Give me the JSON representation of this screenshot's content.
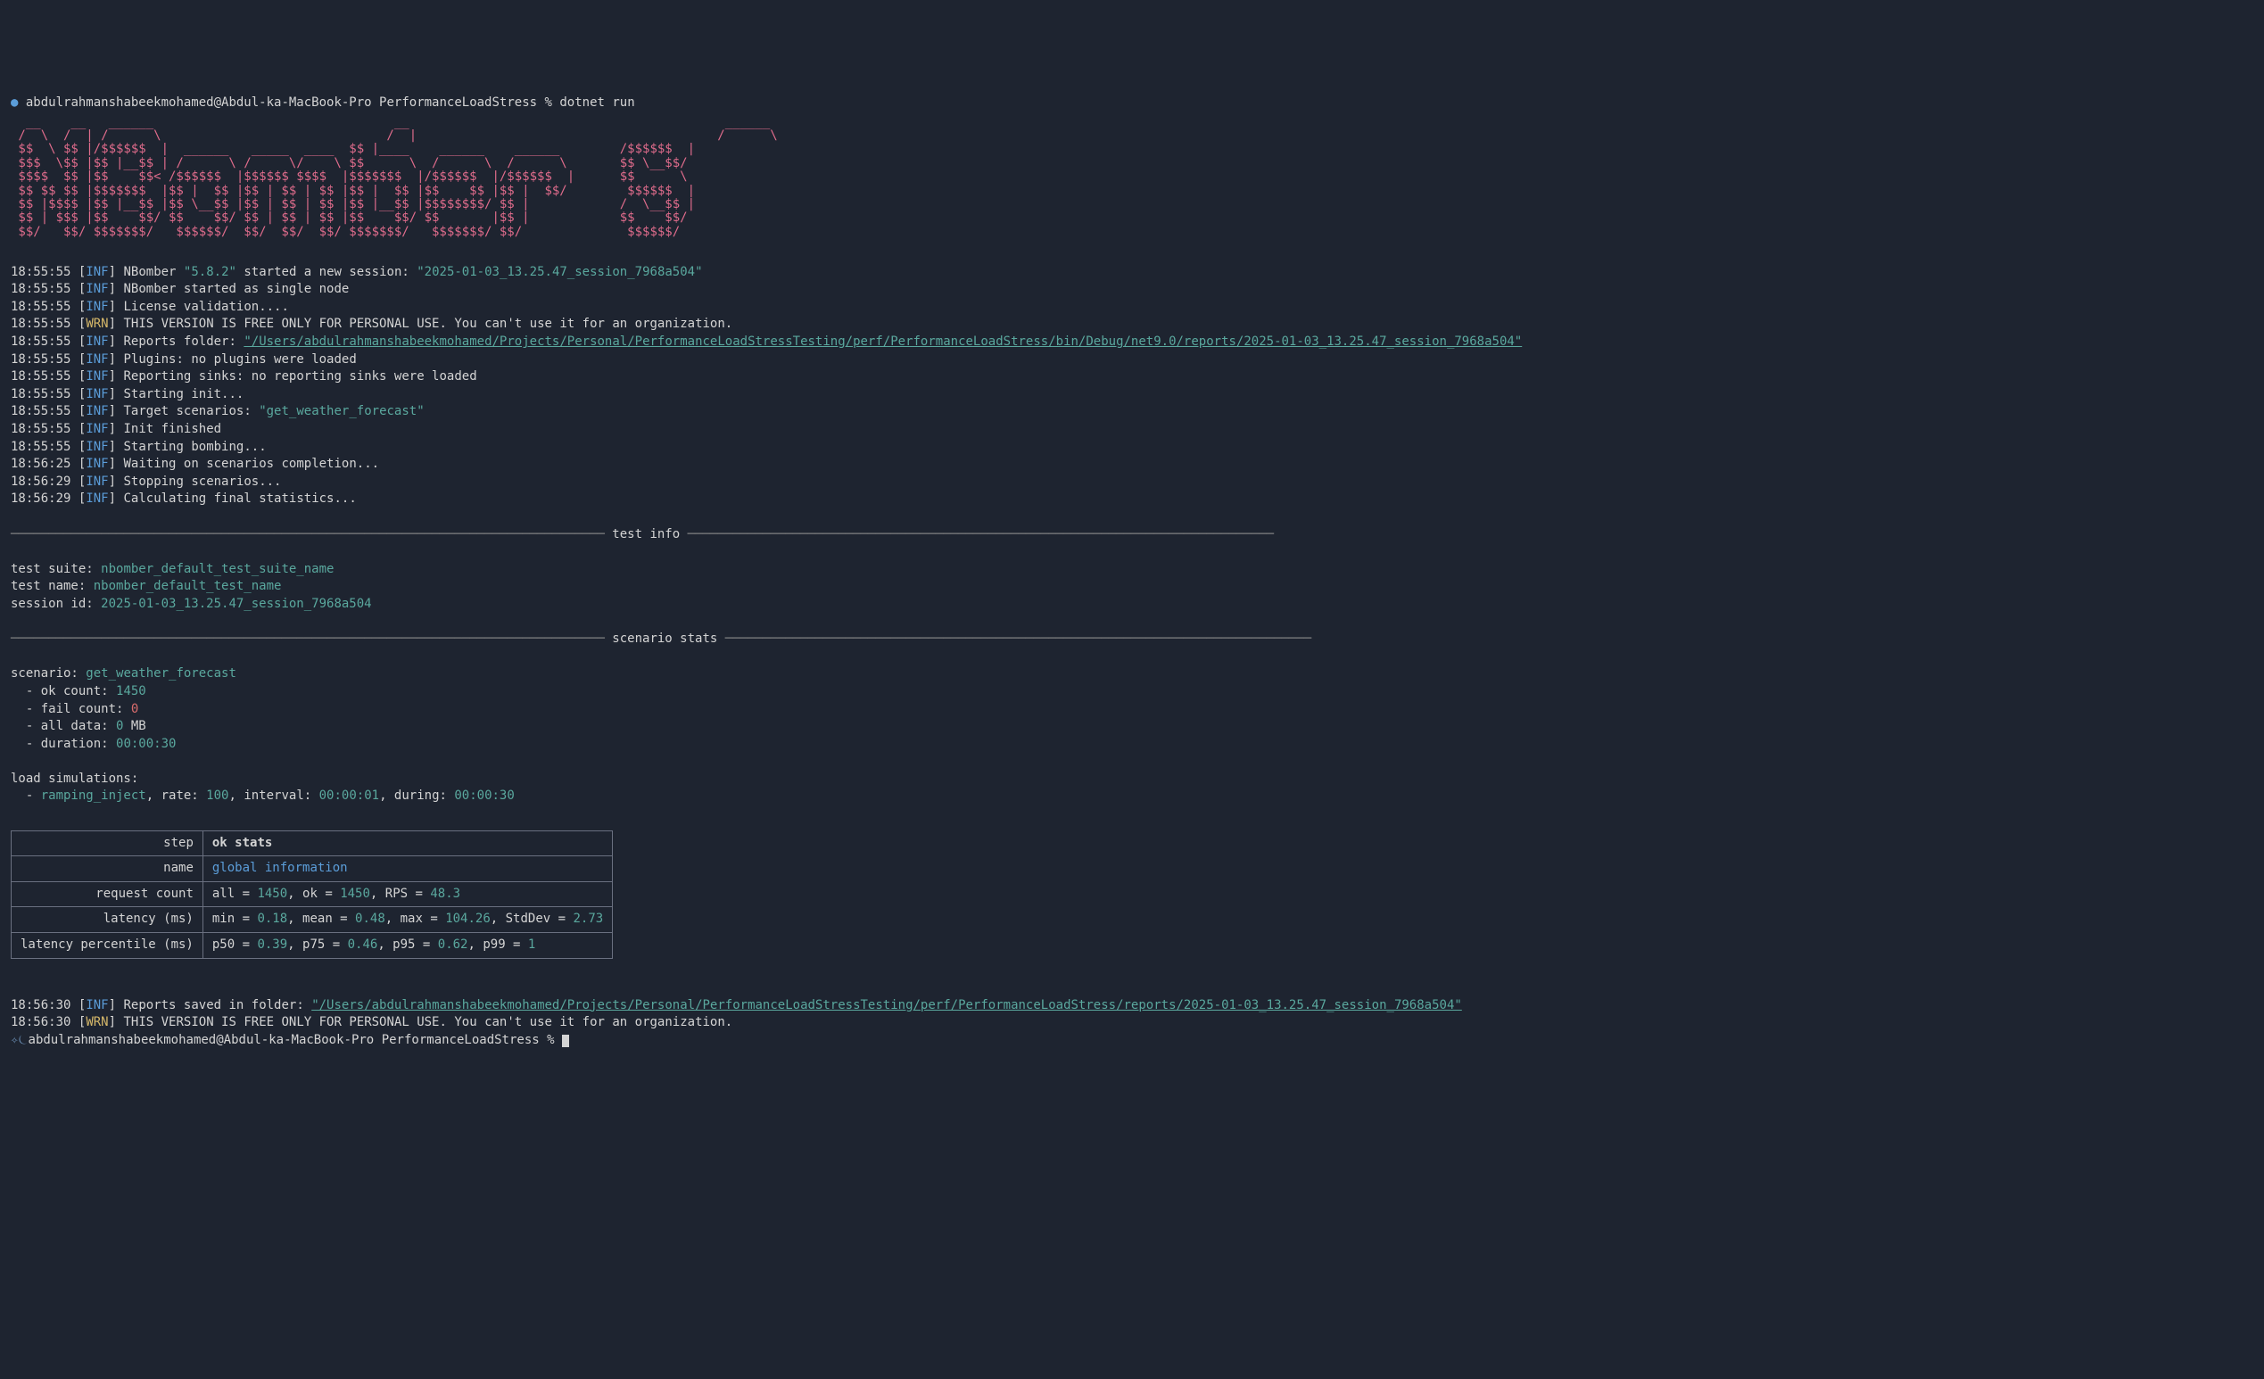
{
  "prompt1": {
    "dot": "●",
    "user_host": "abdulrahmanshabeekmohamed@Abdul-ka-MacBook-Pro",
    "cwd": "PerformanceLoadStress",
    "sep": "%",
    "cmd": "dotnet run"
  },
  "ascii_art": "  __    __   ______                                __                                          ______  \n /  \\  /  | /      \\                              /  |                                        /      \\ \n $$  \\ $$ |/$$$$$$  |  ______   _____  ____  $$ |____    ______    ______        /$$$$$$  |\n $$$  \\$$ |$$ |__$$ | /      \\ /     \\/    \\ $$      \\  /      \\  /      \\       $$ \\__$$/ \n $$$$  $$ |$$    $$< /$$$$$$  |$$$$$$ $$$$  |$$$$$$$  |/$$$$$$  |/$$$$$$  |      $$      \\ \n $$ $$ $$ |$$$$$$$  |$$ |  $$ |$$ | $$ | $$ |$$ |  $$ |$$    $$ |$$ |  $$/        $$$$$$  |\n $$ |$$$$ |$$ |__$$ |$$ \\__$$ |$$ | $$ | $$ |$$ |__$$ |$$$$$$$$/ $$ |            /  \\__$$ |\n $$ | $$$ |$$    $$/ $$    $$/ $$ | $$ | $$ |$$    $$/ $$       |$$ |            $$    $$/ \n $$/   $$/ $$$$$$$/   $$$$$$/  $$/  $$/  $$/ $$$$$$$/   $$$$$$$/ $$/              $$$$$$/  ",
  "logs": {
    "l1_ts": "18:55:55",
    "l1_msg_a": "NBomber ",
    "l1_version": "\"5.8.2\"",
    "l1_msg_b": " started a new session: ",
    "l1_session": "\"2025-01-03_13.25.47_session_7968a504\"",
    "l2_ts": "18:55:55",
    "l2_msg": "NBomber started as single node",
    "l3_ts": "18:55:55",
    "l3_msg": "License validation....",
    "l4_ts": "18:55:55",
    "l4_msg": "THIS VERSION IS FREE ONLY FOR PERSONAL USE. You can't use it for an organization.",
    "l5_ts": "18:55:55",
    "l5_msg": "Reports folder: ",
    "l5_path": "\"/Users/abdulrahmanshabeekmohamed/Projects/Personal/PerformanceLoadStressTesting/perf/PerformanceLoadStress/bin/Debug/net9.0/reports/2025-01-03_13.25.47_session_7968a504\"",
    "l6_ts": "18:55:55",
    "l6_msg": "Plugins: no plugins were loaded",
    "l7_ts": "18:55:55",
    "l7_msg": "Reporting sinks: no reporting sinks were loaded",
    "l8_ts": "18:55:55",
    "l8_msg": "Starting init...",
    "l9_ts": "18:55:55",
    "l9_msg": "Target scenarios: ",
    "l9_scn": "\"get_weather_forecast\"",
    "l10_ts": "18:55:55",
    "l10_msg": "Init finished",
    "l11_ts": "18:55:55",
    "l11_msg": "Starting bombing...",
    "l12_ts": "18:56:25",
    "l12_msg": "Waiting on scenarios completion...",
    "l13_ts": "18:56:29",
    "l13_msg": "Stopping scenarios...",
    "l14_ts": "18:56:29",
    "l14_msg": "Calculating final statistics..."
  },
  "section_test_info": " test info ",
  "test_info": {
    "suite_label": "test suite: ",
    "suite_val": "nbomber_default_test_suite_name",
    "name_label": "test name: ",
    "name_val": "nbomber_default_test_name",
    "session_label": "session id: ",
    "session_val": "2025-01-03_13.25.47_session_7968a504"
  },
  "section_scenario_stats": " scenario stats ",
  "scenario": {
    "label": "scenario: ",
    "name": "get_weather_forecast",
    "ok_label": "  - ok count: ",
    "ok_val": "1450",
    "fail_label": "  - fail count: ",
    "fail_val": "0",
    "data_label": "  - all data: ",
    "data_val": "0",
    "data_unit": " MB",
    "dur_label": "  - duration: ",
    "dur_val": "00:00:30"
  },
  "load_sim": {
    "header": "load simulations:",
    "bullet": "  - ",
    "name": "ramping_inject",
    "rate_label": ", rate: ",
    "rate_val": "100",
    "interval_label": ", interval: ",
    "interval_val": "00:00:01",
    "during_label": ", during: ",
    "during_val": "00:00:30"
  },
  "table": {
    "hd_step": "step",
    "hd_ok": "ok stats",
    "r1_label": "name",
    "r1_val": "global information",
    "r2_label": "request count",
    "r2_all_l": "all = ",
    "r2_all_v": "1450",
    "r2_ok_l": ", ok = ",
    "r2_ok_v": "1450",
    "r2_rps_l": ", RPS = ",
    "r2_rps_v": "48.3",
    "r3_label": "latency (ms)",
    "r3_min_l": "min = ",
    "r3_min_v": "0.18",
    "r3_mean_l": ", mean = ",
    "r3_mean_v": "0.48",
    "r3_max_l": ", max = ",
    "r3_max_v": "104.26",
    "r3_sd_l": ", StdDev = ",
    "r3_sd_v": "2.73",
    "r4_label": "latency percentile (ms)",
    "r4_p50_l": "p50 = ",
    "r4_p50_v": "0.39",
    "r4_p75_l": ", p75 = ",
    "r4_p75_v": "0.46",
    "r4_p95_l": ", p95 = ",
    "r4_p95_v": "0.62",
    "r4_p99_l": ", p99 = ",
    "r4_p99_v": "1"
  },
  "tail": {
    "l1_ts": "18:56:30",
    "l1_msg": "Reports saved in folder: ",
    "l1_path": "\"/Users/abdulrahmanshabeekmohamed/Projects/Personal/PerformanceLoadStressTesting/perf/PerformanceLoadStress/reports/2025-01-03_13.25.47_session_7968a504\"",
    "l2_ts": "18:56:30",
    "l2_msg": "THIS VERSION IS FREE ONLY FOR PERSONAL USE. You can't use it for an organization."
  },
  "prompt2": {
    "icons": "✧⏾",
    "user_host": "abdulrahmanshabeekmohamed@Abdul-ka-MacBook-Pro",
    "cwd": "PerformanceLoadStress",
    "sep": "%"
  },
  "rule_left": "───────────────────────────────────────────────────────────────────────────────",
  "rule_right": "──────────────────────────────────────────────────────────────────────────────"
}
